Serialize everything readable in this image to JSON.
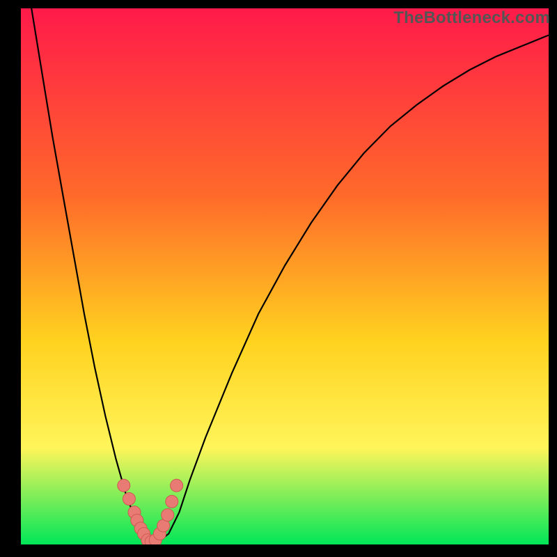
{
  "watermark": "TheBottleneck.com",
  "colors": {
    "frame": "#000000",
    "grad_top": "#ff1a4a",
    "grad_mid1": "#ff6a2a",
    "grad_mid2": "#ffd21f",
    "grad_mid3": "#fff55a",
    "grad_bottom": "#00e658",
    "curve": "#000000",
    "marker_fill": "#e87b73",
    "marker_stroke": "#cc5a52"
  },
  "chart_data": {
    "type": "line",
    "title": "",
    "xlabel": "",
    "ylabel": "",
    "xlim": [
      0,
      100
    ],
    "ylim": [
      0,
      100
    ],
    "x": [
      2,
      4,
      6,
      8,
      10,
      12,
      14,
      16,
      18,
      20,
      22,
      23,
      24,
      25,
      26,
      28,
      30,
      32,
      35,
      40,
      45,
      50,
      55,
      60,
      65,
      70,
      75,
      80,
      85,
      90,
      95,
      100
    ],
    "values": [
      100,
      88,
      76,
      65,
      54,
      43,
      33,
      24,
      16,
      9,
      4,
      2,
      0.5,
      0,
      0.5,
      2,
      6,
      12,
      20,
      32,
      43,
      52,
      60,
      67,
      73,
      78,
      82,
      85.5,
      88.5,
      91,
      93,
      95
    ],
    "series": [
      {
        "name": "bottleneck-curve",
        "x": [
          2,
          4,
          6,
          8,
          10,
          12,
          14,
          16,
          18,
          20,
          22,
          23,
          24,
          25,
          26,
          28,
          30,
          32,
          35,
          40,
          45,
          50,
          55,
          60,
          65,
          70,
          75,
          80,
          85,
          90,
          95,
          100
        ],
        "values": [
          100,
          88,
          76,
          65,
          54,
          43,
          33,
          24,
          16,
          9,
          4,
          2,
          0.5,
          0,
          0.5,
          2,
          6,
          12,
          20,
          32,
          43,
          52,
          60,
          67,
          73,
          78,
          82,
          85.5,
          88.5,
          91,
          93,
          95
        ]
      }
    ],
    "markers": {
      "name": "highlighted-points",
      "x": [
        19.5,
        20.5,
        21.5,
        22,
        22.7,
        23.3,
        24,
        24.7,
        25.5,
        26.3,
        27,
        27.8,
        28.6,
        29.5
      ],
      "values": [
        11,
        8.5,
        6,
        4.5,
        3,
        2,
        0.8,
        0.5,
        0.8,
        2,
        3.5,
        5.5,
        8,
        11
      ]
    }
  }
}
